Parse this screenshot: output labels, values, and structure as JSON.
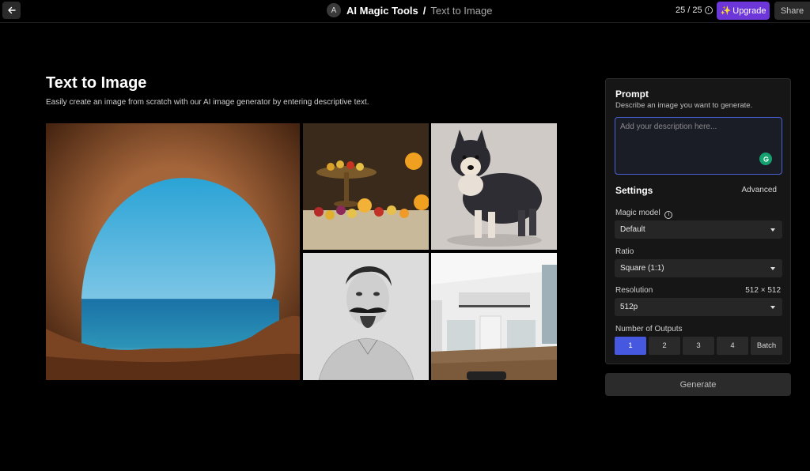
{
  "header": {
    "app_avatar_letter": "A",
    "app_name": "AI Magic Tools",
    "separator": "/",
    "page_crumb": "Text to Image",
    "credits": "25 / 25",
    "upgrade_label": "Upgrade",
    "share_label": "Share",
    "accent_color": "#6d36d9"
  },
  "main": {
    "title": "Text to Image",
    "subtitle": "Easily create an image from scratch with our AI image generator by entering descriptive text."
  },
  "panel": {
    "prompt_title": "Prompt",
    "prompt_subtitle": "Describe an image you want to generate.",
    "prompt_placeholder": "Add your description here...",
    "prompt_value": "",
    "settings_title": "Settings",
    "advanced_label": "Advanced",
    "model_label": "Magic model",
    "model_value": "Default",
    "ratio_label": "Ratio",
    "ratio_value": "Square (1:1)",
    "resolution_label": "Resolution",
    "resolution_size": "512 × 512",
    "resolution_value": "512p",
    "outputs_label": "Number of Outputs",
    "outputs": [
      "1",
      "2",
      "3",
      "4",
      "Batch"
    ],
    "outputs_selected": "1",
    "generate_label": "Generate",
    "active_color": "#4658e0"
  },
  "icons": [
    "arrow-left-icon",
    "info-icon",
    "sparkle-icon",
    "grammar-check-icon",
    "chevron-down-icon"
  ]
}
